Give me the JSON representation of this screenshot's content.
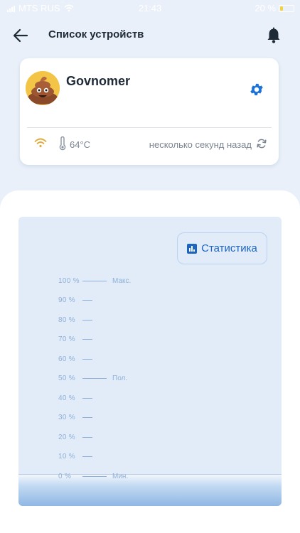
{
  "status_bar": {
    "carrier": "MTS RUS",
    "time": "21:43",
    "battery": "20 %"
  },
  "header": {
    "title": "Список устройств"
  },
  "device": {
    "name": "Govnomer",
    "temperature": "64°C",
    "last_update": "несколько секунд назад"
  },
  "stats_button": {
    "label": "Статистика"
  },
  "level_scale": [
    {
      "percent": "100 %",
      "mark": "Макс."
    },
    {
      "percent": "90 %",
      "mark": ""
    },
    {
      "percent": "80 %",
      "mark": ""
    },
    {
      "percent": "70 %",
      "mark": ""
    },
    {
      "percent": "60 %",
      "mark": ""
    },
    {
      "percent": "50 %",
      "mark": "Пол."
    },
    {
      "percent": "40 %",
      "mark": ""
    },
    {
      "percent": "30 %",
      "mark": ""
    },
    {
      "percent": "20 %",
      "mark": ""
    },
    {
      "percent": "10 %",
      "mark": ""
    },
    {
      "percent": "0 %",
      "mark": "Мин."
    }
  ],
  "fill_level_percent": 0,
  "colors": {
    "accent": "#1d65c1",
    "background": "#e9f0fa",
    "tank": "#e2ecf8",
    "scale": "#8fb0d9"
  },
  "icons": [
    "back-arrow-icon",
    "bell-icon",
    "gear-icon",
    "wifi-icon",
    "thermometer-icon",
    "refresh-icon",
    "bar-chart-icon"
  ]
}
